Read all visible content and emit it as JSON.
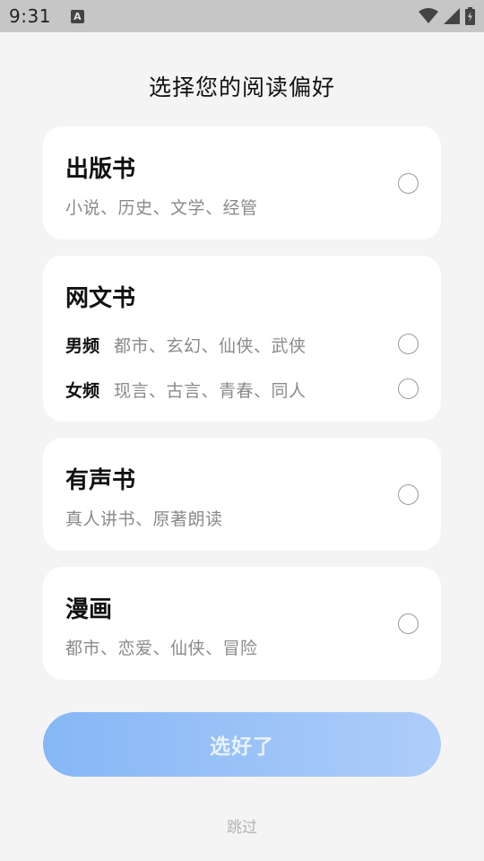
{
  "status_bar": {
    "time": "9:31",
    "a_icon": "A"
  },
  "page": {
    "title": "选择您的阅读偏好"
  },
  "cards": {
    "published": {
      "title": "出版书",
      "subtitle": "小说、历史、文学、经管"
    },
    "web_novels": {
      "title": "网文书",
      "male": {
        "label": "男频",
        "subtitle": "都市、玄幻、仙侠、武侠"
      },
      "female": {
        "label": "女频",
        "subtitle": "现言、古言、青春、同人"
      }
    },
    "audio": {
      "title": "有声书",
      "subtitle": "真人讲书、原著朗读"
    },
    "comics": {
      "title": "漫画",
      "subtitle": "都市、恋爱、仙侠、冒险"
    }
  },
  "actions": {
    "confirm_label": "选好了",
    "skip_label": "跳过"
  },
  "colors": {
    "button_start": "#86b7f6",
    "button_end": "#aecdf9",
    "background": "#f4f4f4"
  }
}
